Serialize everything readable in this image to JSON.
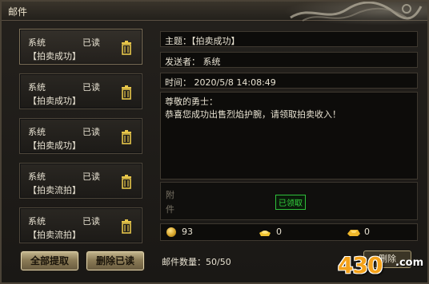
{
  "window": {
    "title": "邮件"
  },
  "mail_list": [
    {
      "sender": "系统",
      "status": "已读",
      "subject": "【拍卖成功】"
    },
    {
      "sender": "系统",
      "status": "已读",
      "subject": "【拍卖成功】"
    },
    {
      "sender": "系统",
      "status": "已读",
      "subject": "【拍卖成功】"
    },
    {
      "sender": "系统",
      "status": "已读",
      "subject": "【拍卖流拍】"
    },
    {
      "sender": "系统",
      "status": "已读",
      "subject": "【拍卖流拍】"
    }
  ],
  "buttons": {
    "claim_all": "全部提取",
    "delete_read": "删除已读",
    "delete": "删除"
  },
  "detail": {
    "subject_label": "主题：【拍卖成功】",
    "sender_label": "发送者：  系统",
    "time_label": "时间：  2020/5/8 14:08:49",
    "body_greeting": "尊敬的勇士：",
    "body_text": "恭喜您成功出售烈焰护腕，请领取拍卖收入！",
    "attachment_label_1": "附",
    "attachment_label_2": "件",
    "claimed_badge": "已领取"
  },
  "resources": {
    "gold": "93",
    "silver_ingot": "0",
    "gold_ingot": "0"
  },
  "mail_count": "邮件数量：50/50",
  "watermark": {
    "text": "430",
    "suffix": ".com"
  },
  "colors": {
    "claimed_green": "#35d43f",
    "button_gold": "#c2b48c",
    "coin": "#d6a42a",
    "watermark": "#f4a21a"
  }
}
